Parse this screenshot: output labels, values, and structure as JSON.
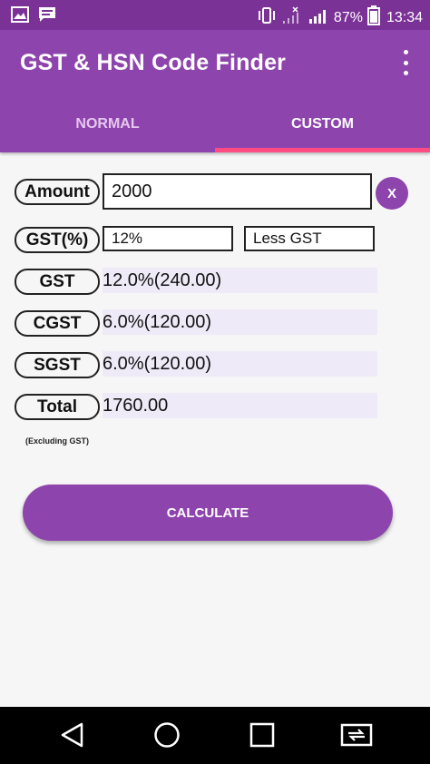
{
  "status_bar": {
    "battery_percent": "87%",
    "time": "13:34"
  },
  "app_bar": {
    "title": "GST & HSN Code Finder"
  },
  "tabs": [
    {
      "label": "NORMAL",
      "selected": false
    },
    {
      "label": "CUSTOM",
      "selected": true
    }
  ],
  "form": {
    "amount_label": "Amount",
    "amount_value": "2000",
    "clear_label": "X",
    "gst_percent_label": "GST(%)",
    "gst_percent_value": "12%",
    "gst_mode_value": "Less GST"
  },
  "results": {
    "gst_label": "GST",
    "gst_value": "12.0%(240.00)",
    "cgst_label": "CGST",
    "cgst_value": "6.0%(120.00)",
    "sgst_label": "SGST",
    "sgst_value": "6.0%(120.00)",
    "total_label": "Total",
    "total_value": "1760.00",
    "note": "(Excluding GST)"
  },
  "actions": {
    "calculate_label": "CALCULATE"
  },
  "colors": {
    "primary": "#8e44ad",
    "status_bar": "#7b3296",
    "tab_indicator": "#ff4d84",
    "result_background": "#efeaf7"
  },
  "icons": {
    "status_left": [
      "image-icon",
      "message-icon"
    ],
    "status_right": [
      "vibrate-icon",
      "no-signal-icon",
      "signal-icon",
      "battery-icon"
    ],
    "nav": [
      "back-icon",
      "home-icon",
      "recents-icon",
      "screen-mirror-icon"
    ]
  }
}
